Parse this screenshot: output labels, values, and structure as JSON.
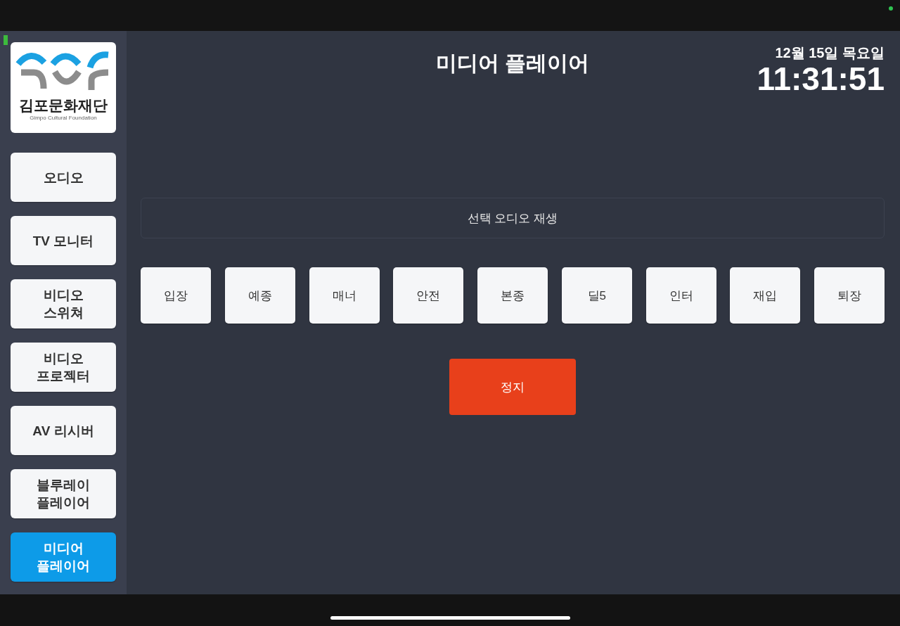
{
  "sidebar": {
    "logo": {
      "name": "김포문화재단",
      "subtitle": "Gimpo Cultural Foundation"
    },
    "items": [
      {
        "label": "오디오",
        "selected": false
      },
      {
        "label": "TV 모니터",
        "selected": false
      },
      {
        "label": "비디오\n스위쳐",
        "selected": false
      },
      {
        "label": "비디오\n프로젝터",
        "selected": false
      },
      {
        "label": "AV 리시버",
        "selected": false
      },
      {
        "label": "블루레이\n플레이어",
        "selected": false
      },
      {
        "label": "미디어\n플레이어",
        "selected": true
      }
    ]
  },
  "header": {
    "title": "미디어 플레이어",
    "date": "12월 15일 목요일",
    "time": "11:31:51"
  },
  "main": {
    "selection_display": "선택 오디오 재생",
    "tracks": [
      "입장",
      "예종",
      "매너",
      "안전",
      "본종",
      "딜5",
      "인터",
      "재입",
      "퇴장"
    ],
    "stop_button": "정지"
  }
}
